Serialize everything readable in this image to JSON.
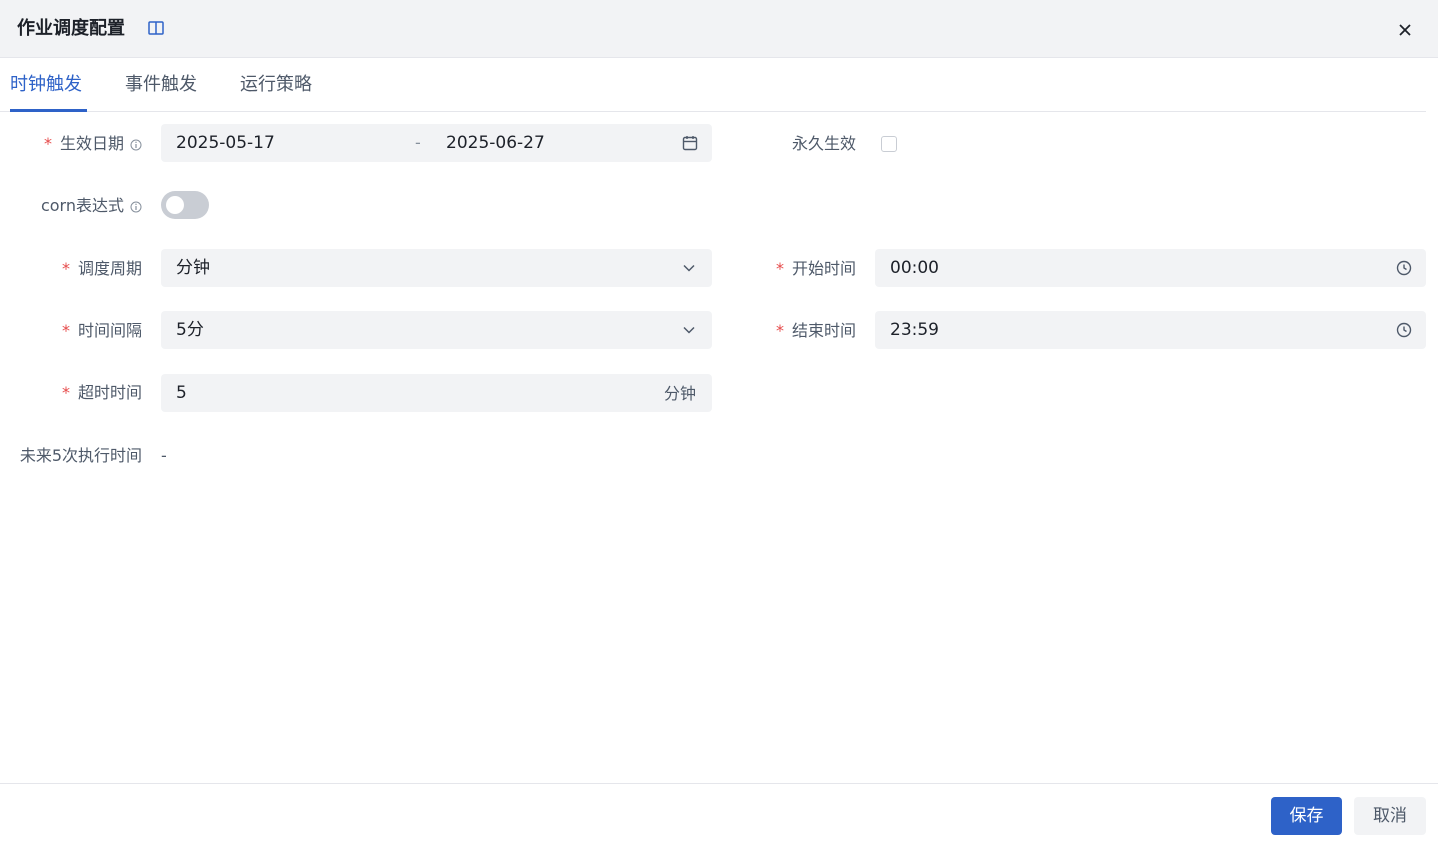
{
  "header": {
    "title": "作业调度配置",
    "doc_icon": "book-icon",
    "close_icon": "close-icon"
  },
  "tabs": [
    {
      "label": "时钟触发",
      "active": true
    },
    {
      "label": "事件触发",
      "active": false
    },
    {
      "label": "运行策略",
      "active": false
    }
  ],
  "form": {
    "required_mark": "*",
    "effective_date": {
      "label": "生效日期",
      "start": "2025-05-17",
      "separator": "-",
      "end": "2025-06-27",
      "icon": "calendar-icon"
    },
    "permanent": {
      "label": "永久生效",
      "checked": false
    },
    "cron": {
      "label": "corn表达式",
      "enabled": false
    },
    "cycle": {
      "label": "调度周期",
      "value": "分钟",
      "icon": "chevron-down-icon"
    },
    "start_time": {
      "label": "开始时间",
      "value": "00:00",
      "icon": "clock-icon"
    },
    "interval": {
      "label": "时间间隔",
      "value": "5分",
      "icon": "chevron-down-icon"
    },
    "end_time": {
      "label": "结束时间",
      "value": "23:59",
      "icon": "clock-icon"
    },
    "timeout": {
      "label": "超时时间",
      "value": "5",
      "unit": "分钟"
    },
    "next_runs": {
      "label": "未来5次执行时间",
      "value": "-"
    }
  },
  "footer": {
    "save_label": "保存",
    "cancel_label": "取消"
  },
  "colors": {
    "primary": "#2e62c8",
    "required": "#e64a4a",
    "field_bg": "#f2f3f5"
  }
}
